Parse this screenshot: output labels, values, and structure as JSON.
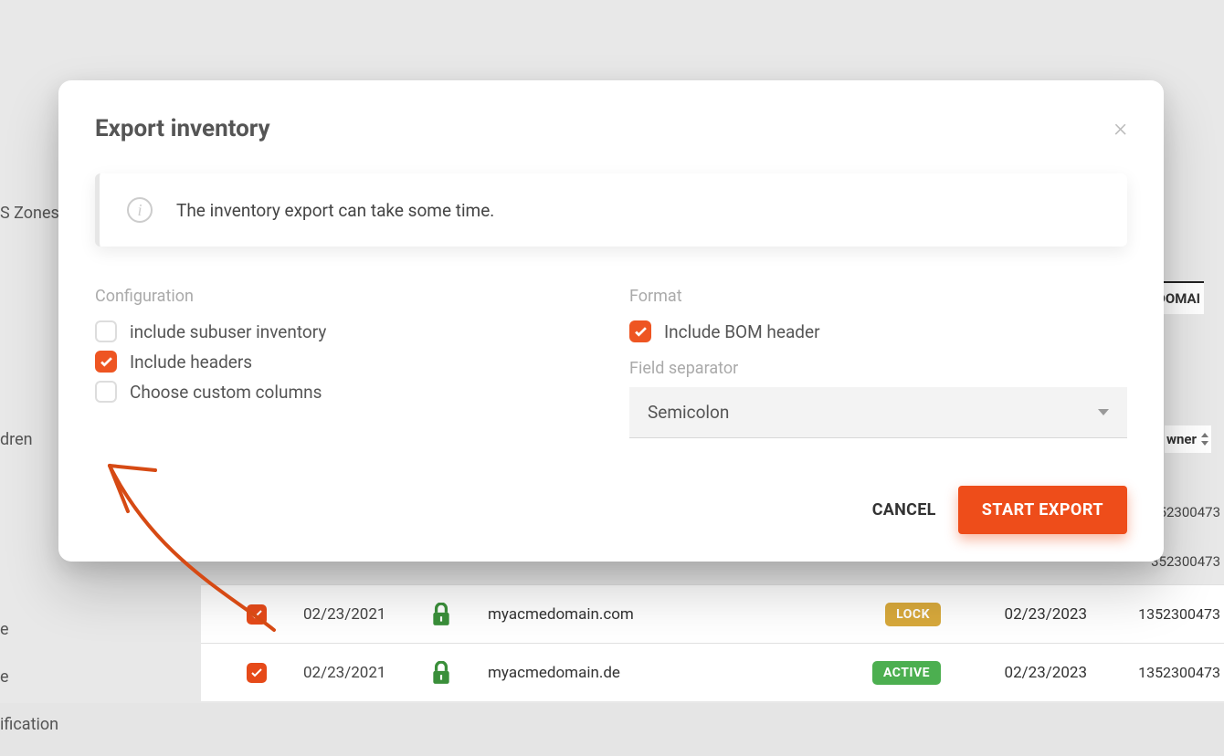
{
  "modal": {
    "title": "Export inventory",
    "info_text": "The inventory export can take some time.",
    "configuration": {
      "section_label": "Configuration",
      "include_subuser": {
        "label": "include subuser inventory",
        "checked": false
      },
      "include_headers": {
        "label": "Include headers",
        "checked": true
      },
      "custom_columns": {
        "label": "Choose custom columns",
        "checked": false
      }
    },
    "format": {
      "section_label": "Format",
      "include_bom": {
        "label": "Include BOM header",
        "checked": true
      },
      "field_separator_label": "Field separator",
      "field_separator_value": "Semicolon"
    },
    "actions": {
      "cancel": "CANCEL",
      "start_export": "START EXPORT"
    }
  },
  "background": {
    "sidebar_fragments": [
      "S Zones",
      "dren",
      "e",
      "e",
      "ification"
    ],
    "column_domain": "DOMAI",
    "column_owner": "wner",
    "rows": [
      {
        "date": "02/23/2021",
        "domain": "myacmedomain.com",
        "status": "LOCK",
        "status_class": "status-lock",
        "expire": "02/23/2023",
        "id": "1352300473"
      },
      {
        "date": "02/23/2021",
        "domain": "myacmedomain.de",
        "status": "ACTIVE",
        "status_class": "status-active",
        "expire": "02/23/2023",
        "id": "1352300473"
      }
    ],
    "id_fragments": [
      "352300473",
      "352300473"
    ]
  }
}
